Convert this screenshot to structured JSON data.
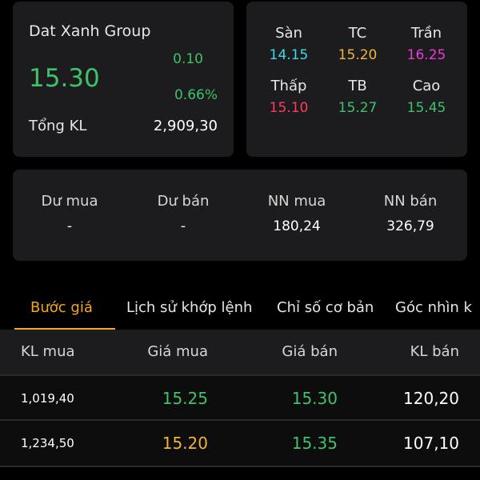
{
  "colors": {
    "green": "#3ec26a",
    "yellow": "#f2b33d",
    "magenta": "#e83bd8",
    "cyan": "#3fd8ea",
    "red": "#ff3b5c",
    "accent": "#f5a623"
  },
  "quote": {
    "company": "Dat Xanh Group",
    "price": "15.30",
    "change": "0.10",
    "change_pct": "0.66%",
    "total_volume_label": "Tổng KL",
    "total_volume": "2,909,30"
  },
  "range": [
    {
      "label": "Sàn",
      "value": "14.15",
      "color": "#3fd8ea"
    },
    {
      "label": "TC",
      "value": "15.20",
      "color": "#f2b33d"
    },
    {
      "label": "Trần",
      "value": "16.25",
      "color": "#e83bd8"
    },
    {
      "label": "Thấp",
      "value": "15.10",
      "color": "#ff3b5c"
    },
    {
      "label": "TB",
      "value": "15.27",
      "color": "#3ec26a"
    },
    {
      "label": "Cao",
      "value": "15.45",
      "color": "#3ec26a"
    }
  ],
  "volume": [
    {
      "label": "Dư mua",
      "value": "-"
    },
    {
      "label": "Dư bán",
      "value": "-"
    },
    {
      "label": "NN mua",
      "value": "180,24"
    },
    {
      "label": "NN bán",
      "value": "326,79"
    }
  ],
  "tabs": [
    "Bước giá",
    "Lịch sử khớp lệnh",
    "Chỉ số cơ bản",
    "Góc nhìn k"
  ],
  "table": {
    "headers": [
      "KL mua",
      "Giá mua",
      "Giá bán",
      "KL bán"
    ],
    "rows": [
      {
        "kl_mua": "1,019,40",
        "gia_mua": "15.25",
        "gia_mua_color": "#3ec26a",
        "gia_ban": "15.30",
        "gia_ban_color": "#3ec26a",
        "kl_ban": "120,20"
      },
      {
        "kl_mua": "1,234,50",
        "gia_mua": "15.20",
        "gia_mua_color": "#f2b33d",
        "gia_ban": "15.35",
        "gia_ban_color": "#3ec26a",
        "kl_ban": "107,10"
      }
    ]
  }
}
